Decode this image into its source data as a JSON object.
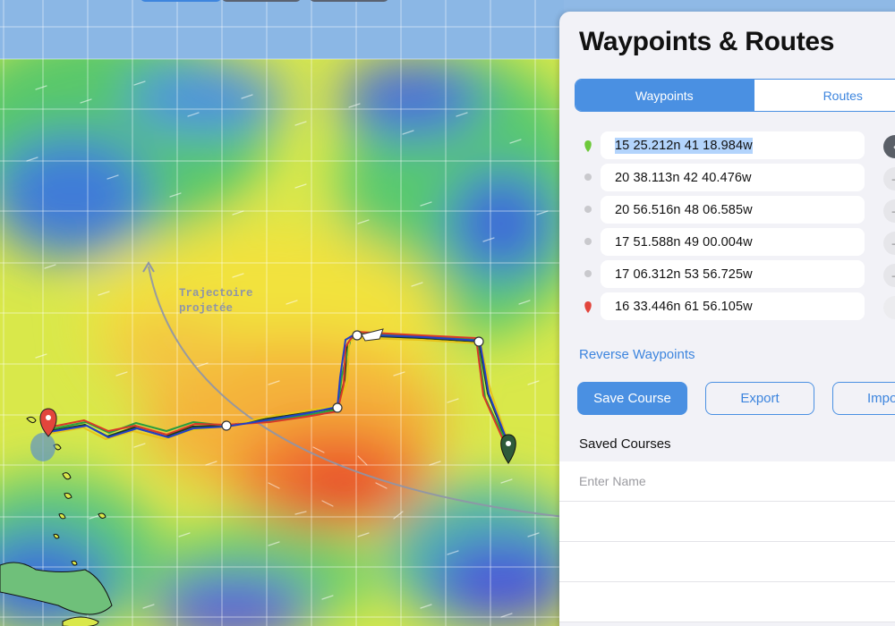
{
  "map": {
    "annotation_line1": "Trajectoire",
    "annotation_line2": "projetée"
  },
  "panel": {
    "title": "Waypoints & Routes",
    "tabs": [
      {
        "label": "Waypoints",
        "active": true
      },
      {
        "label": "Routes",
        "active": false
      }
    ],
    "waypoints": [
      {
        "coord": "15 25.212n 41 18.984w",
        "marker": "green-pin",
        "selected": true
      },
      {
        "coord": "20 38.113n 42 40.476w",
        "marker": "gray-dot"
      },
      {
        "coord": "20 56.516n 48 06.585w",
        "marker": "gray-dot"
      },
      {
        "coord": "17 51.588n 49 00.004w",
        "marker": "gray-dot"
      },
      {
        "coord": "17 06.312n 53 56.725w",
        "marker": "gray-dot"
      },
      {
        "coord": "16 33.446n 61 56.105w",
        "marker": "red-pin"
      }
    ],
    "reverse_label": "Reverse Waypoints",
    "save_label": "Save Course",
    "export_label": "Export",
    "import_label": "Impo",
    "saved_courses_title": "Saved Courses",
    "name_placeholder": "Enter Name"
  },
  "colors": {
    "accent": "#4a90e2",
    "start_pin": "#e2453c",
    "end_pin": "#2e5a3a",
    "green_marker": "#6dc93a"
  }
}
